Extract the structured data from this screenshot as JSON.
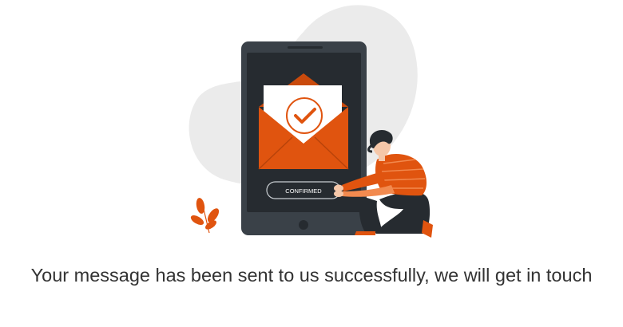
{
  "illustration": {
    "button_label": "CONFIRMED",
    "icon": "envelope-checkmark-icon",
    "colors": {
      "accent": "#e0540f",
      "device": "#3a4148",
      "screen": "#262b30",
      "blob": "#ebebeb",
      "letter": "#ffffff"
    }
  },
  "message": {
    "text": "Your message has been sent to us successfully, we will get in touch"
  }
}
